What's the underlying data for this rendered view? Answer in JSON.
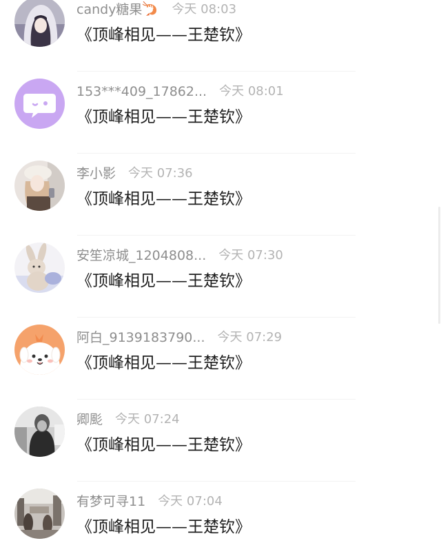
{
  "comments": [
    {
      "user": "candy糖果",
      "badge": "shrimp-emoji-icon",
      "time": "今天 08:03",
      "text": "《顶峰相见——王楚钦》",
      "avatar": "avatar-hooded-girl"
    },
    {
      "user": "153***409_17862...",
      "time": "今天 08:01",
      "text": "《顶峰相见——王楚钦》",
      "avatar": "avatar-chat-bubble-icon"
    },
    {
      "user": "李小影",
      "time": "今天 07:36",
      "text": "《顶峰相见——王楚钦》",
      "avatar": "avatar-girl-with-hat"
    },
    {
      "user": "安笙凉城_1204808...",
      "time": "今天 07:30",
      "text": "《顶峰相见——王楚钦》",
      "avatar": "avatar-plush-bunny"
    },
    {
      "user": "阿白_9139183790...",
      "time": "今天 07:29",
      "text": "《顶峰相见——王楚钦》",
      "avatar": "avatar-cartoon-puppy"
    },
    {
      "user": "卿颩",
      "time": "今天 07:24",
      "text": "《顶峰相见——王楚钦》",
      "avatar": "avatar-bw-girl"
    },
    {
      "user": "有梦可寻11",
      "time": "今天 07:04",
      "text": "《顶峰相见——王楚钦》",
      "avatar": "avatar-street-scene"
    }
  ],
  "colors": {
    "username": "#8e8e8e",
    "timestamp": "#b3b3b3",
    "comment_text": "#1e1e1e",
    "divider": "#f2f2f2",
    "lavender_avatar": "#c9a7f2"
  }
}
